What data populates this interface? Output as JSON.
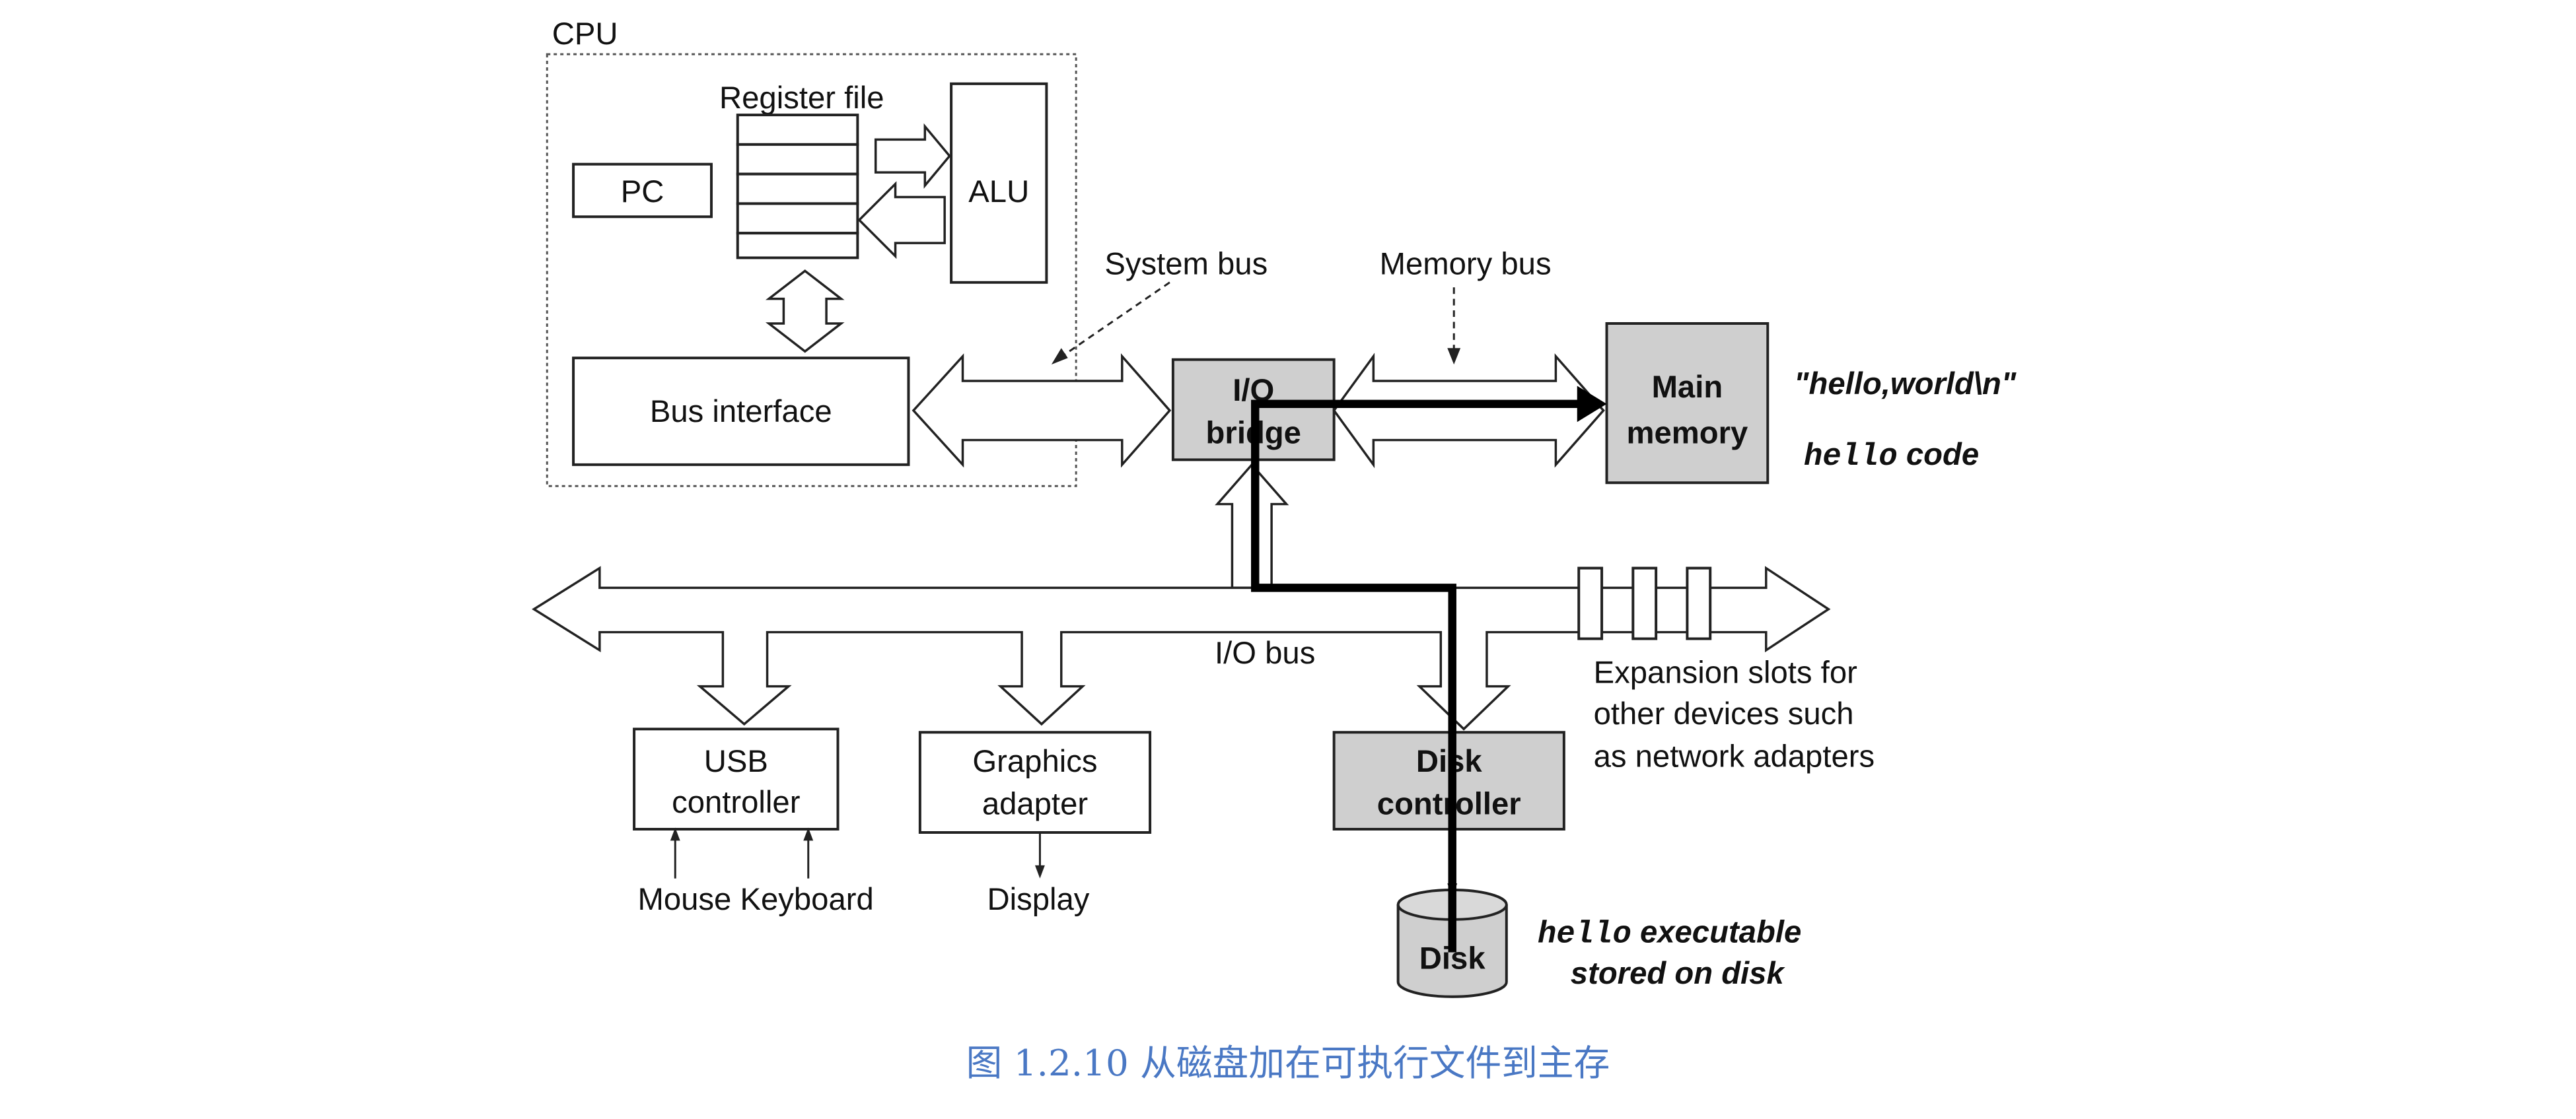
{
  "labels": {
    "cpu": "CPU",
    "register_file": "Register file",
    "pc": "PC",
    "alu": "ALU",
    "bus_interface": "Bus interface",
    "system_bus": "System bus",
    "memory_bus": "Memory bus",
    "io_bridge": [
      "I/O",
      "bridge"
    ],
    "main_memory": [
      "Main",
      "memory"
    ],
    "hello_world": "\"hello,world\\n\"",
    "hello_code_mono": "hello",
    "hello_code_text": " code",
    "io_bus": "I/O bus",
    "usb_controller": [
      "USB",
      "controller"
    ],
    "graphics_adapter": [
      "Graphics",
      "adapter"
    ],
    "disk_controller": [
      "Disk",
      "controller"
    ],
    "expansion": [
      "Expansion slots for",
      "other devices such",
      "as network adapters"
    ],
    "mouse_keyboard": "Mouse Keyboard",
    "display": "Display",
    "disk": "Disk",
    "hello_exec_mono": "hello",
    "hello_exec_text": " executable",
    "stored_on_disk": "stored on disk"
  },
  "caption": "图 1.2.10 从磁盘加在可执行文件到主存",
  "colors": {
    "highlight_box": "#cfcfcf",
    "caption": "#4a78c4",
    "path": "#000000"
  }
}
